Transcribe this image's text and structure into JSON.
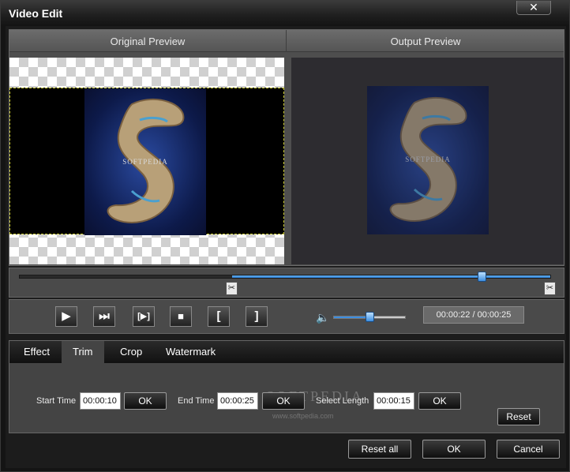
{
  "window": {
    "title": "Video Edit",
    "close_label": "✕"
  },
  "preview": {
    "original_title": "Original Preview",
    "output_title": "Output Preview",
    "watermark": "SOFTPEDIA"
  },
  "timeline": {
    "progress": 0.87,
    "trim_start": 0.4,
    "trim_end": 1.0
  },
  "controls": {
    "play": "▶",
    "step": "⏭",
    "frame": "[▶]",
    "stop": "■",
    "mark_in": "[",
    "mark_out": "]",
    "volume_icon": "🔈",
    "volume_level": 0.5,
    "time_display": "00:00:22 / 00:00:25"
  },
  "tabs": [
    {
      "label": "Effect"
    },
    {
      "label": "Trim"
    },
    {
      "label": "Crop"
    },
    {
      "label": "Watermark"
    }
  ],
  "trim": {
    "start_label": "Start Time",
    "start_value": "00:00:10",
    "start_ok": "OK",
    "end_label": "End Time",
    "end_value": "00:00:25",
    "end_ok": "OK",
    "length_label": "Select Length",
    "length_value": "00:00:15",
    "length_ok": "OK",
    "reset": "Reset",
    "watermark": "SOFTPEDIA",
    "watermark_url": "www.softpedia.com"
  },
  "footer": {
    "reset_all": "Reset all",
    "ok": "OK",
    "cancel": "Cancel"
  }
}
